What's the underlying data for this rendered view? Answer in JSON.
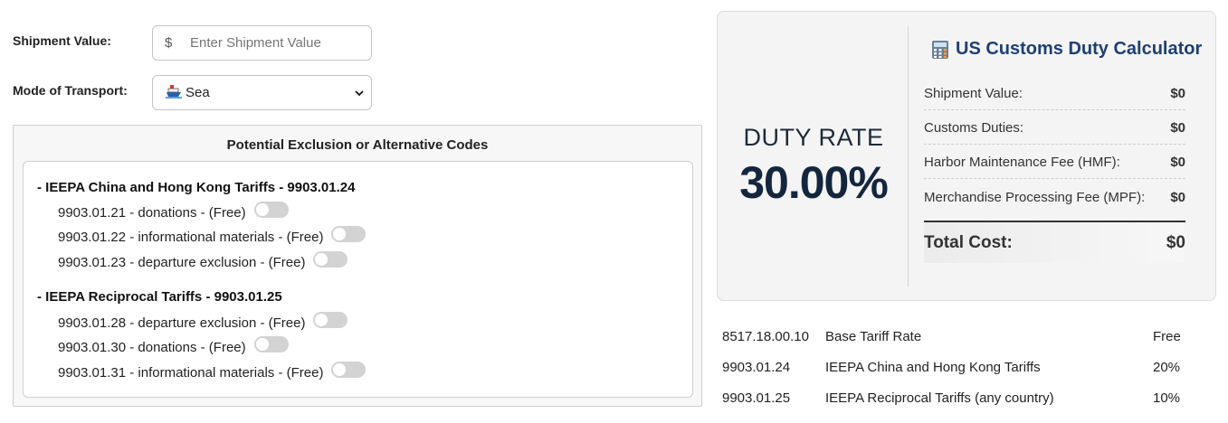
{
  "shipment": {
    "label": "Shipment Value:",
    "currency": "$",
    "placeholder": "Enter Shipment Value"
  },
  "transport": {
    "label": "Mode of Transport:",
    "selected": "Sea",
    "icon": "ship-icon"
  },
  "exclusions": {
    "title": "Potential Exclusion or Alternative Codes",
    "groups": [
      {
        "title": "- IEEPA China and Hong Kong Tariffs - 9903.01.24",
        "items": [
          {
            "label": "9903.01.21 - donations - (Free)",
            "enabled": false
          },
          {
            "label": "9903.01.22 - informational materials - (Free)",
            "enabled": false
          },
          {
            "label": "9903.01.23 - departure exclusion - (Free)",
            "enabled": false
          }
        ]
      },
      {
        "title": "- IEEPA Reciprocal Tariffs - 9903.01.25",
        "items": [
          {
            "label": "9903.01.28 - departure exclusion - (Free)",
            "enabled": false
          },
          {
            "label": "9903.01.30 - donations - (Free)",
            "enabled": false
          },
          {
            "label": "9903.01.31 - informational materials - (Free)",
            "enabled": false
          }
        ]
      }
    ]
  },
  "calculator": {
    "rate_label": "DUTY RATE",
    "rate_value": "30.00%",
    "title": "US Customs Duty Calculator",
    "title_icon": "calculator-icon",
    "lines": [
      {
        "label": "Shipment Value:",
        "value": "$0"
      },
      {
        "label": "Customs Duties:",
        "value": "$0"
      },
      {
        "label": "Harbor Maintenance Fee (HMF):",
        "value": "$0"
      },
      {
        "label": "Merchandise Processing Fee (MPF):",
        "value": "$0"
      }
    ],
    "total": {
      "label": "Total Cost:",
      "value": "$0"
    }
  },
  "rates": [
    {
      "code": "8517.18.00.10",
      "desc": "Base Tariff Rate",
      "rate": "Free"
    },
    {
      "code": "9903.01.24",
      "desc": "IEEPA China and Hong Kong Tariffs",
      "rate": "20%"
    },
    {
      "code": "9903.01.25",
      "desc": "IEEPA Reciprocal Tariffs (any country)",
      "rate": "10%"
    }
  ],
  "colors": {
    "title_blue": "#1f3f74",
    "rate_navy": "#14263d",
    "toggle_off": "#d3d3d3"
  }
}
